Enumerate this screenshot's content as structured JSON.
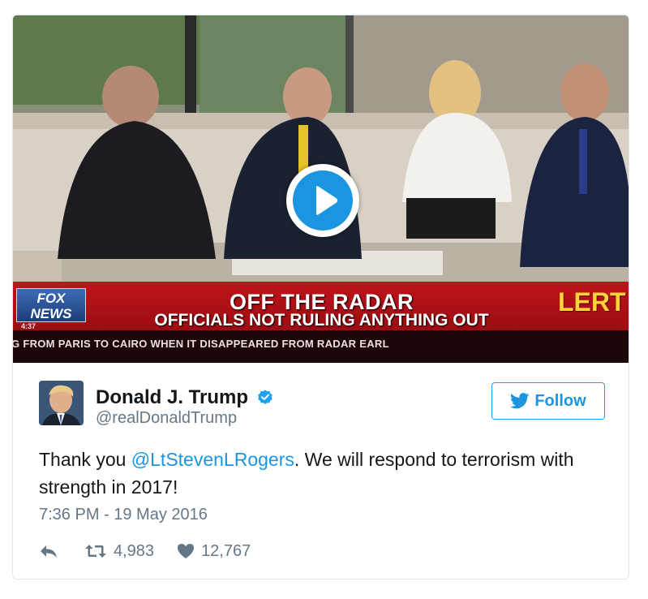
{
  "video": {
    "network_logo_line1": "FOX",
    "network_logo_line2": "NEWS",
    "logo_time": "4:37",
    "headline_line1": "OFF THE RADAR",
    "headline_line2": "OFFICIALS NOT RULING ANYTHING OUT",
    "alert_badge": "LERT",
    "crawl_text": "G FROM PARIS TO CAIRO WHEN IT DISAPPEARED FROM RADAR EARL",
    "play_icon": "play-icon"
  },
  "author": {
    "display_name": "Donald J. Trump",
    "handle": "@realDonaldTrump",
    "verified_icon": "verified-badge-icon"
  },
  "follow_button": {
    "label": "Follow",
    "icon": "twitter-bird-icon"
  },
  "tweet": {
    "text_before": "Thank you ",
    "mention": "@LtStevenLRogers",
    "text_after": ". We will respond to terrorism with strength in 2017!"
  },
  "timestamp": "7:36 PM - 19 May 2016",
  "actions": {
    "reply_icon": "reply-icon",
    "retweet_icon": "retweet-icon",
    "retweet_count": "4,983",
    "like_icon": "heart-icon",
    "like_count": "12,767"
  },
  "colors": {
    "link": "#1b95e0",
    "muted": "#657786",
    "text": "#14171a",
    "border": "#e1e8ed"
  }
}
